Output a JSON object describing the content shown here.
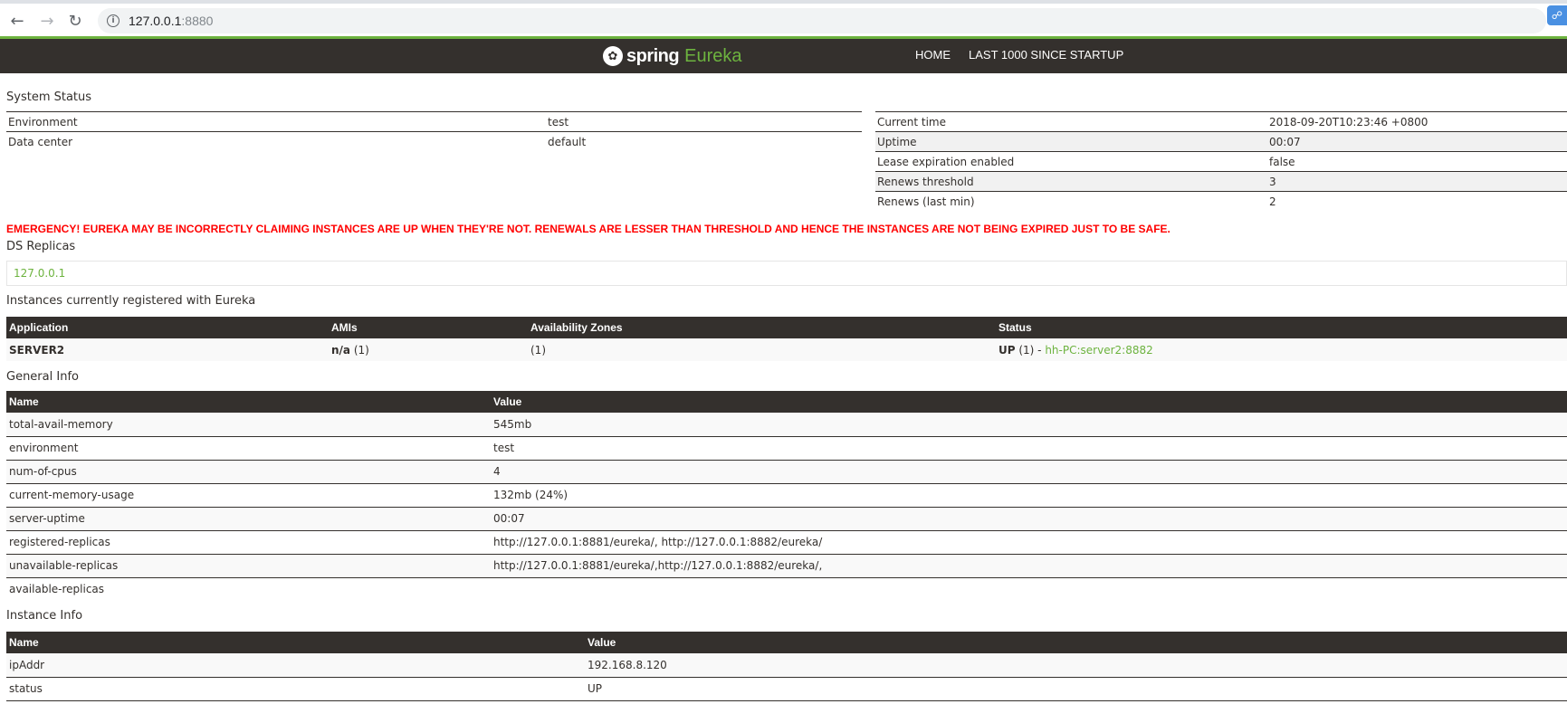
{
  "browser": {
    "url_host": "127.0.0.1",
    "url_port": ":8880"
  },
  "navbar": {
    "brand_spring": "spring",
    "brand_eureka": "Eureka",
    "links": [
      "HOME",
      "LAST 1000 SINCE STARTUP"
    ]
  },
  "system_status": {
    "title": "System Status",
    "left": [
      {
        "key": "Environment",
        "value": "test"
      },
      {
        "key": "Data center",
        "value": "default"
      }
    ],
    "right": [
      {
        "key": "Current time",
        "value": "2018-09-20T10:23:46 +0800"
      },
      {
        "key": "Uptime",
        "value": "00:07"
      },
      {
        "key": "Lease expiration enabled",
        "value": "false"
      },
      {
        "key": "Renews threshold",
        "value": "3"
      },
      {
        "key": "Renews (last min)",
        "value": "2"
      }
    ]
  },
  "emergency": "EMERGENCY! EUREKA MAY BE INCORRECTLY CLAIMING INSTANCES ARE UP WHEN THEY'RE NOT. RENEWALS ARE LESSER THAN THRESHOLD AND HENCE THE INSTANCES ARE NOT BEING EXPIRED JUST TO BE SAFE.",
  "ds_replicas": {
    "title": "DS Replicas",
    "items": [
      "127.0.0.1"
    ]
  },
  "instances": {
    "title": "Instances currently registered with Eureka",
    "headers": [
      "Application",
      "AMIs",
      "Availability Zones",
      "Status"
    ],
    "rows": [
      {
        "application": "SERVER2",
        "amis_bold": "n/a",
        "amis_count": " (1)",
        "zones": "(1)",
        "status_bold": "UP",
        "status_count": " (1) - ",
        "status_link": "hh-PC:server2:8882"
      }
    ]
  },
  "general_info": {
    "title": "General Info",
    "headers": [
      "Name",
      "Value"
    ],
    "rows": [
      {
        "name": "total-avail-memory",
        "value": "545mb"
      },
      {
        "name": "environment",
        "value": "test"
      },
      {
        "name": "num-of-cpus",
        "value": "4"
      },
      {
        "name": "current-memory-usage",
        "value": "132mb (24%)"
      },
      {
        "name": "server-uptime",
        "value": "00:07"
      },
      {
        "name": "registered-replicas",
        "value": "http://127.0.0.1:8881/eureka/, http://127.0.0.1:8882/eureka/"
      },
      {
        "name": "unavailable-replicas",
        "value": "http://127.0.0.1:8881/eureka/,http://127.0.0.1:8882/eureka/,"
      },
      {
        "name": "available-replicas",
        "value": ""
      }
    ]
  },
  "instance_info": {
    "title": "Instance Info",
    "headers": [
      "Name",
      "Value"
    ],
    "rows": [
      {
        "name": "ipAddr",
        "value": "192.168.8.120"
      },
      {
        "name": "status",
        "value": "UP"
      }
    ]
  }
}
